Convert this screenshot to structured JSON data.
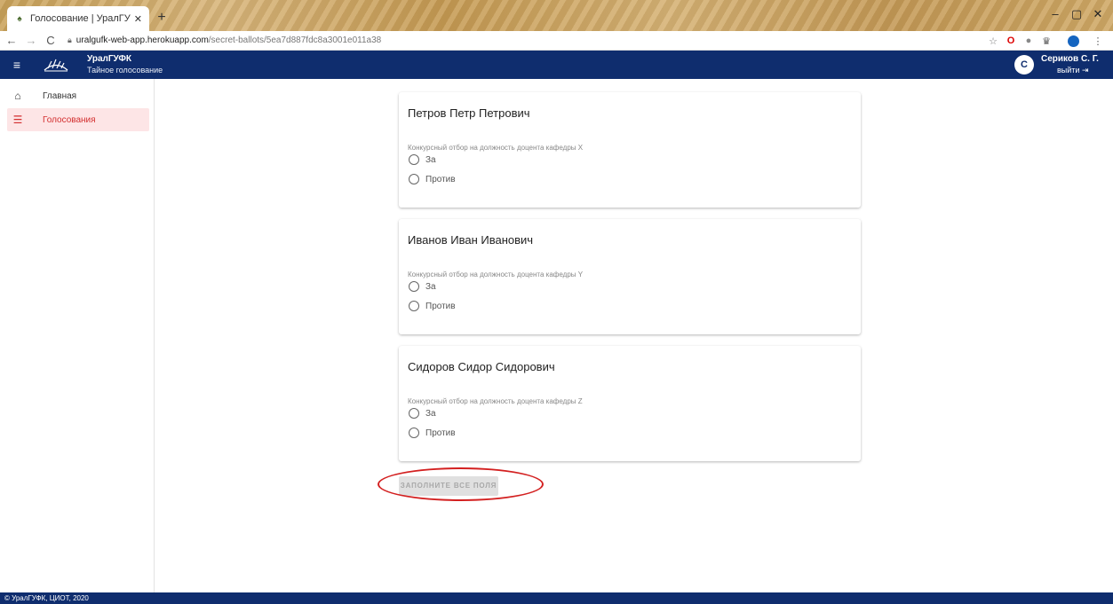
{
  "browser": {
    "tab_title": "Голосование | УралГУФК. Тайн",
    "tab_close": "✕",
    "new_tab": "+",
    "url_host": "uralgufk-web-app.herokuapp.com",
    "url_path": "/secret-ballots/5ea7d887fdc8a3001e011a38",
    "minimize": "–",
    "maximize": "▢",
    "close": "✕"
  },
  "header": {
    "brand_name": "УралГУФК",
    "brand_subtitle": "Тайное голосование",
    "avatar_letter": "С",
    "user_name": "Сериков С. Г.",
    "logout_label": "выйти"
  },
  "sidebar": {
    "items": [
      {
        "label": "Главная",
        "icon": "home-icon"
      },
      {
        "label": "Голосования",
        "icon": "list-icon"
      }
    ]
  },
  "ballots": [
    {
      "name": "Петров Петр Петрович",
      "description": "Конкурсный отбор на должность доцента кафедры X",
      "options": [
        "За",
        "Против"
      ]
    },
    {
      "name": "Иванов Иван Иванович",
      "description": "Конкурсный отбор на должность доцента кафедры Y",
      "options": [
        "За",
        "Против"
      ]
    },
    {
      "name": "Сидоров Сидор Сидорович",
      "description": "Конкурсный отбор на должность доцента кафедры Z",
      "options": [
        "За",
        "Против"
      ]
    }
  ],
  "submit_label": "ЗАПОЛНИТЕ ВСЕ ПОЛЯ",
  "footer": "© УралГУФК, ЦИОТ, 2020",
  "colors": {
    "primary": "#0f2d6e",
    "accent": "#d32f2f",
    "highlight": "#d32020"
  }
}
